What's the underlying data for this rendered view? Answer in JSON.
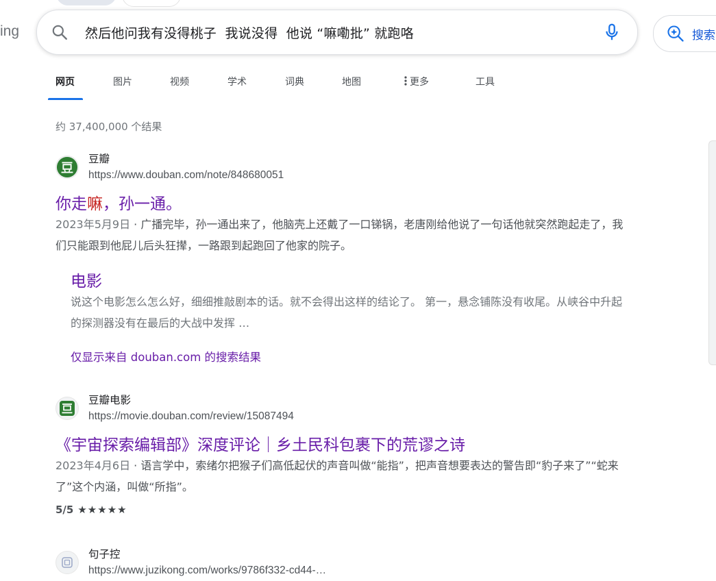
{
  "logo_fragment": "ing",
  "search": {
    "query": "然后他问我有没得桃子  我说没得  他说 “嘛嘞批” 就跑咯",
    "button_label": "搜索"
  },
  "tabs": [
    {
      "label": "网页",
      "active": true
    },
    {
      "label": "图片"
    },
    {
      "label": "视频"
    },
    {
      "label": "学术"
    },
    {
      "label": "词典"
    },
    {
      "label": "地图"
    },
    {
      "label": "更多"
    },
    {
      "label": "工具"
    }
  ],
  "result_count": "约 37,400,000 个结果",
  "results": [
    {
      "site_name": "豆瓣",
      "url": "https://www.douban.com/note/848680051",
      "title_pre": "你走",
      "title_hl": "嘛",
      "title_post": "，孙一通。",
      "date": "2023年5月9日",
      "snippet": "广播完毕，孙一通出来了，他脑壳上还戴了一口锑锅，老唐刚给他说了一句话他就突然跑起走了，我们只能跟到他屁儿后头狂撵，一路跟到起跑回了他家的院子。",
      "sub": {
        "title": "电影",
        "snippet": "说这个电影怎么怎么好，细细推敲剧本的话。就不会得出这样的结论了。 第一，悬念铺陈没有收尾。从峡谷中升起的探测器没有在最后的大战中发挥 …"
      },
      "only_show": "仅显示来自 douban.com 的搜索结果"
    },
    {
      "site_name": "豆瓣电影",
      "url": "https://movie.douban.com/review/15087494",
      "title": "《宇宙探索编辑部》深度评论｜乡土民科包裹下的荒谬之诗",
      "date": "2023年4月6日",
      "snippet": "语言学中，索绪尔把猴子们高低起伏的声音叫做“能指”，把声音想要表达的警告即“豹子来了”“蛇来了”这个内涵，叫做“所指”。",
      "rating_text": "5/5",
      "rating_value": 5
    },
    {
      "site_name": "句子控",
      "url": "https://www.juzikong.com/works/9786f332-cd44-…"
    }
  ],
  "separator": " · ",
  "colors": {
    "link_visited": "#681da8",
    "highlight": "#c5221f",
    "tab_indicator": "#1a73e8",
    "douban_green": "#2e7d32"
  }
}
